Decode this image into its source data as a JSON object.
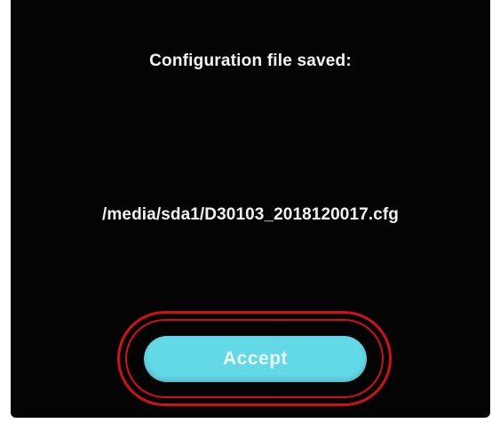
{
  "dialog": {
    "title": "Configuration file saved:",
    "file_path": "/media/sda1/D30103_2018120017.cfg",
    "accept_label": "Accept"
  },
  "colors": {
    "background": "#040404",
    "text": "#f4f4f4",
    "button": "#63d8e6",
    "highlight": "#d20f1c"
  }
}
